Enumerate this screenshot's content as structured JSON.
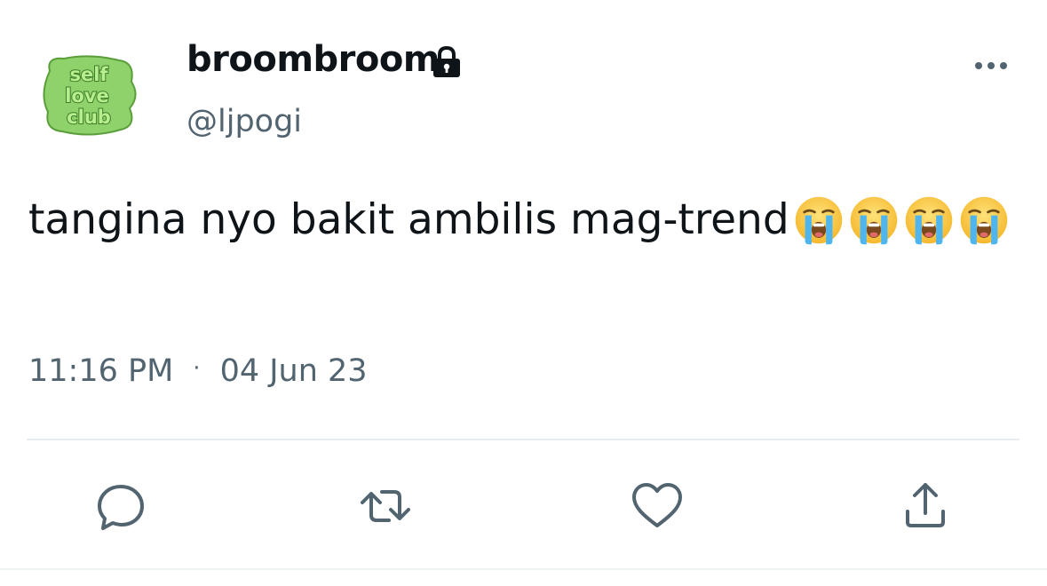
{
  "user": {
    "display_name": "broombroom",
    "handle": "@ljpogi",
    "protected_icon": "lock-icon",
    "avatar_text": [
      "self",
      "love",
      "club"
    ]
  },
  "tweet": {
    "text": "tangina nyo bakit ambilis mag-trend",
    "emoji_name": "loudly-crying-face",
    "emoji_count": 4,
    "time": "11:16 PM",
    "separator": "·",
    "date": "04 Jun 23"
  },
  "actions": {
    "reply_icon": "reply-icon",
    "retweet_icon": "retweet-icon",
    "like_icon": "heart-icon",
    "share_icon": "share-icon",
    "more_icon": "more-icon"
  },
  "colors": {
    "text_primary": "#0f1419",
    "text_secondary": "#536471",
    "avatar_green": "#8fd16a",
    "avatar_dark": "#3f7d2a",
    "divider": "#e6ecf0"
  }
}
